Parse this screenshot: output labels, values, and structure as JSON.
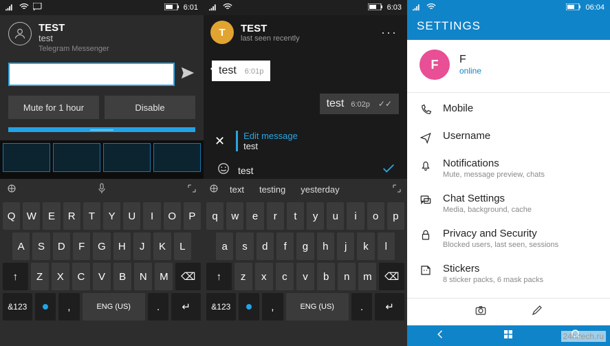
{
  "panel1": {
    "status": {
      "time": "6:01"
    },
    "notification": {
      "title": "TEST",
      "subtitle": "test",
      "app": "Telegram Messenger",
      "mute_label": "Mute for 1 hour",
      "disable_label": "Disable"
    },
    "keyboard": {
      "row1": [
        "Q",
        "W",
        "E",
        "R",
        "T",
        "Y",
        "U",
        "I",
        "O",
        "P"
      ],
      "row2": [
        "A",
        "S",
        "D",
        "F",
        "G",
        "H",
        "J",
        "K",
        "L"
      ],
      "row3_shift": "↑",
      "row3": [
        "Z",
        "X",
        "C",
        "V",
        "B",
        "N",
        "M"
      ],
      "row3_bksp": "⌫",
      "row4": {
        "sym": "&123",
        "emoji": "☺",
        "lang": "ENG (US)",
        "dot": ".",
        "enter": "↵"
      }
    }
  },
  "panel2": {
    "status": {
      "time": "6:03"
    },
    "header": {
      "avatar_letter": "T",
      "title": "TEST",
      "subtitle": "last seen recently",
      "more": "···"
    },
    "messages": {
      "incoming": {
        "text": "test",
        "time": "6:01p"
      },
      "outgoing": {
        "text": "test",
        "time": "6:02p"
      }
    },
    "edit": {
      "label": "Edit message",
      "text": "test",
      "close": "✕"
    },
    "compose": {
      "text": "test"
    },
    "suggestions": [
      "text",
      "testing",
      "yesterday"
    ],
    "keyboard": {
      "row1": [
        "q",
        "w",
        "e",
        "r",
        "t",
        "y",
        "u",
        "i",
        "o",
        "p"
      ],
      "row2": [
        "a",
        "s",
        "d",
        "f",
        "g",
        "h",
        "j",
        "k",
        "l"
      ],
      "row3_shift": "↑",
      "row3": [
        "z",
        "x",
        "c",
        "v",
        "b",
        "n",
        "m"
      ],
      "row3_bksp": "⌫",
      "row4": {
        "sym": "&123",
        "emoji": "☺",
        "lang": "ENG (US)",
        "dot": ".",
        "enter": "↵"
      }
    }
  },
  "panel3": {
    "status": {
      "time": "06:04"
    },
    "title": "SETTINGS",
    "profile": {
      "avatar_letter": "F",
      "name": "F",
      "status": "online"
    },
    "items": [
      {
        "label": "Mobile",
        "sub": ""
      },
      {
        "label": "Username",
        "sub": ""
      },
      {
        "label": "Notifications",
        "sub": "Mute, message preview, chats"
      },
      {
        "label": "Chat Settings",
        "sub": "Media, background, cache"
      },
      {
        "label": "Privacy and Security",
        "sub": "Blocked users, last seen, sessions"
      },
      {
        "label": "Stickers",
        "sub": "8 sticker packs, 6 mask packs"
      }
    ]
  },
  "watermark": "24hitech.ru"
}
